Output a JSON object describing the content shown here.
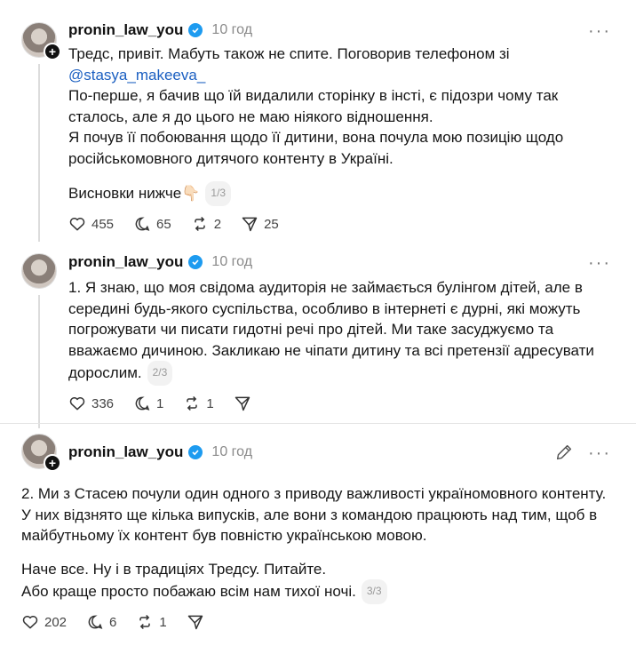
{
  "posts": [
    {
      "username": "pronin_law_you",
      "time": "10 год",
      "lines": [
        "Тредс, привіт. Мабуть також не спите. Поговорив телефоном зі",
        "@stasya_makeeva_",
        "По-перше, я бачив що їй видалили сторінку в інсті, є підозри чому так",
        "сталось, але я до цього не маю ніякого відношення.",
        "Я почув її побоювання щодо її дитини, вона почула мою позицію щодо",
        "російськомовного дитячого контенту в Україні."
      ],
      "final_line": "Висновки нижче👇🏻",
      "pager": "1/3",
      "likes": "455",
      "comments": "65",
      "reposts": "2",
      "shares": "25"
    },
    {
      "username": "pronin_law_you",
      "time": "10 год",
      "lines": [
        "1. Я знаю, що моя свідома аудиторія не займається булінгом дітей, але в",
        "середині будь-якого суспільства, особливо в інтернеті є дурні, які можуть",
        "погрожувати чи писати гидотні речі про дітей. Ми таке засуджуємо та",
        "вважаємо дичиною. Закликаю не чіпати дитину та всі претензії адресувати"
      ],
      "final_line": "дорослим.",
      "pager": "2/3",
      "likes": "336",
      "comments": "1",
      "reposts": "1"
    },
    {
      "username": "pronin_law_you",
      "time": "10 год",
      "lines": [
        "2. Ми з Стасею почули один одного з приводу важливості україномовного контенту.",
        "У них відзнято ще кілька випусків, але вони з командою працюють над тим, щоб в",
        "майбутньому їх контент був повністю українською мовою."
      ],
      "lines2": [
        "Наче все. Ну і в традиціях Тредсу. Питайте."
      ],
      "final_line": "Або краще просто побажаю всім нам тихої ночі.",
      "pager": "3/3",
      "likes": "202",
      "comments": "6",
      "reposts": "1"
    }
  ],
  "colors": {
    "mention": "#1b5fc1",
    "verified": "#1d9bf0"
  }
}
